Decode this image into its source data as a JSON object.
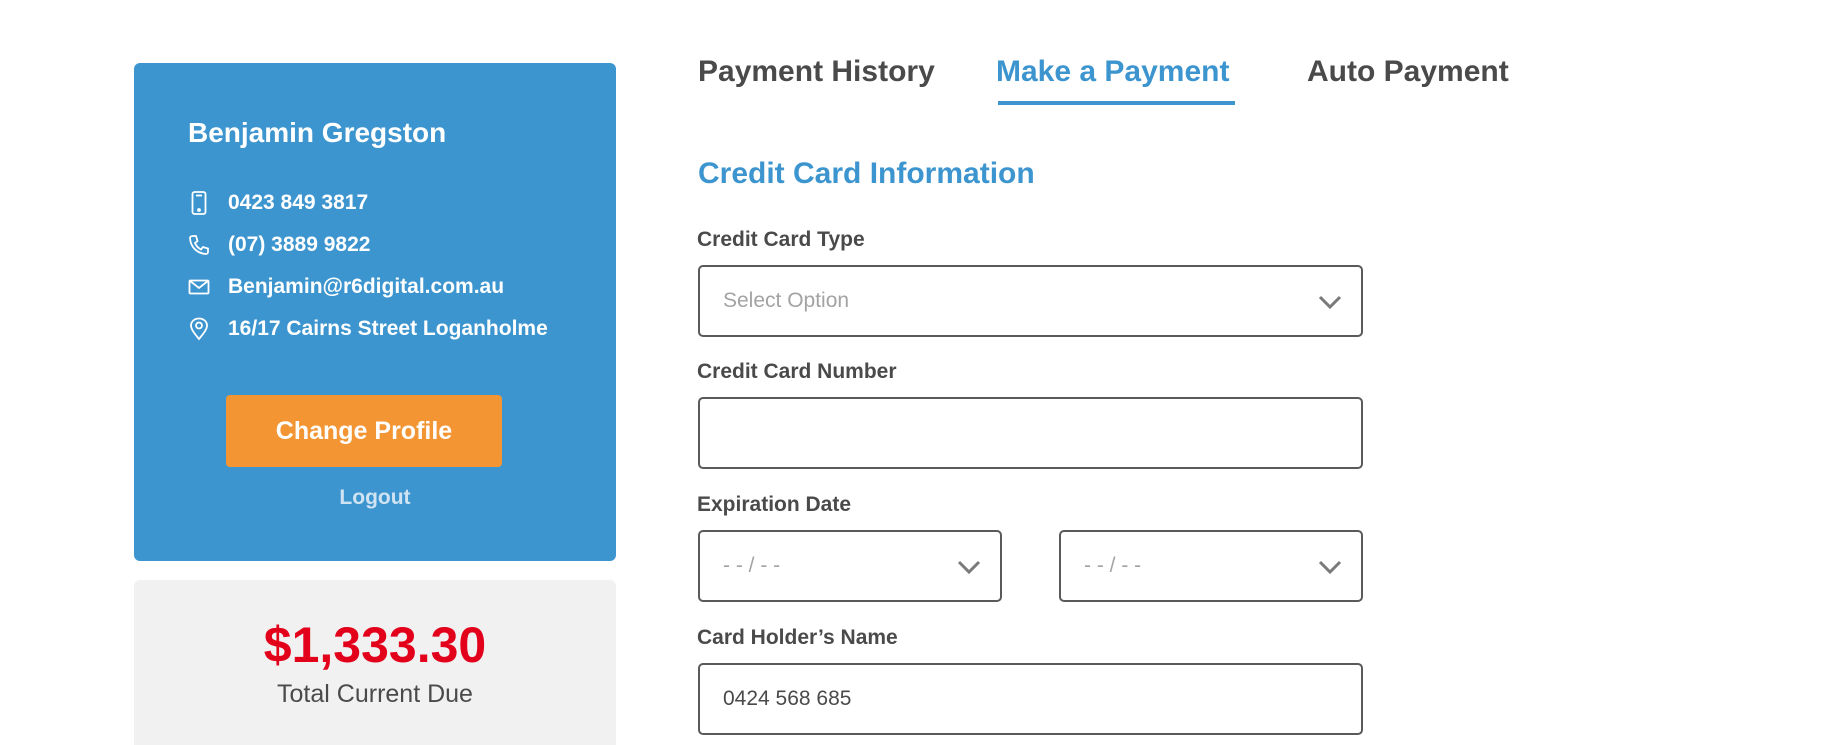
{
  "profile": {
    "name": "Benjamin Gregston",
    "mobile": "0423 849 3817",
    "phone": "(07) 3889 9822",
    "email": "Benjamin@r6digital.com.au",
    "address": "16/17 Cairns Street Loganholme",
    "change_profile_label": "Change Profile",
    "logout_label": "Logout",
    "icons": [
      "mobile-phone-icon",
      "phone-icon",
      "envelope-icon",
      "location-pin-icon"
    ]
  },
  "balance": {
    "amount": "$1,333.30",
    "label": "Total Current Due"
  },
  "tabs": [
    {
      "label": "Payment History",
      "active": false
    },
    {
      "label": "Make a Payment",
      "active": true
    },
    {
      "label": "Auto Payment",
      "active": false
    }
  ],
  "form": {
    "title": "Credit Card Information",
    "card_type": {
      "label": "Credit Card Type",
      "placeholder": "Select Option",
      "value": ""
    },
    "card_number": {
      "label": "Credit Card Number",
      "value": ""
    },
    "expiration": {
      "label": "Expiration Date",
      "month_placeholder": "- - / - -",
      "year_placeholder": "- - / - -"
    },
    "holder_name": {
      "label": "Card Holder’s Name",
      "value": "0424 568 685"
    }
  },
  "colors": {
    "accent": "#3d95cf",
    "button": "#f39532",
    "amount": "#e3001b",
    "due_bg": "#f1f1f1"
  }
}
